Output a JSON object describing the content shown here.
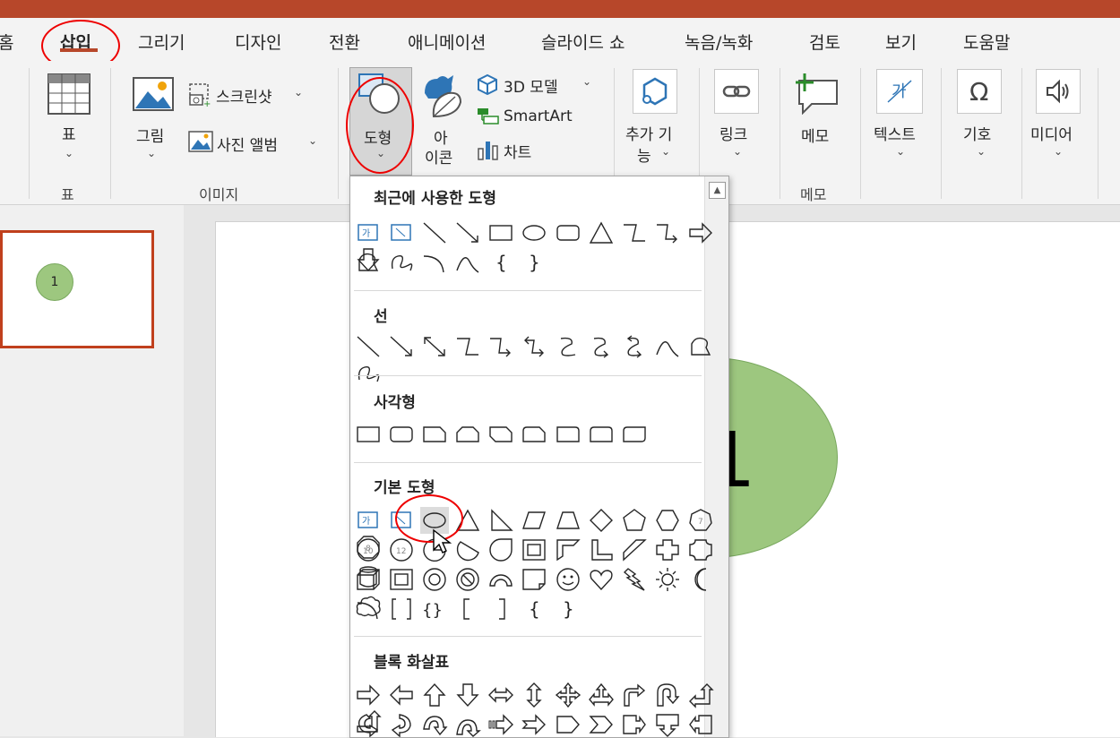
{
  "tabs": [
    {
      "label": "홈",
      "active": false
    },
    {
      "label": "삽입",
      "active": true
    },
    {
      "label": "그리기",
      "active": false
    },
    {
      "label": "디자인",
      "active": false
    },
    {
      "label": "전환",
      "active": false
    },
    {
      "label": "애니메이션",
      "active": false
    },
    {
      "label": "슬라이드 쇼",
      "active": false
    },
    {
      "label": "녹음/녹화",
      "active": false
    },
    {
      "label": "검토",
      "active": false
    },
    {
      "label": "보기",
      "active": false
    },
    {
      "label": "도움말",
      "active": false
    }
  ],
  "ribbon": {
    "table_label": "표",
    "table_group": "표",
    "picture_label": "그림",
    "screenshot_label": "스크린샷",
    "photo_album_label": "사진 앨범",
    "images_group": "이미지",
    "shapes_label": "도형",
    "icons_label_1": "아",
    "icons_label_2": "이콘",
    "model3d_label": "3D 모델",
    "smartart_label": "SmartArt",
    "chart_label": "차트",
    "addins_label_1": "추가 기",
    "addins_label_2": "능",
    "link_label": "링크",
    "comment_label": "메모",
    "comment_group": "메모",
    "text_label": "텍스트",
    "symbol_label": "기호",
    "media_label": "미디어"
  },
  "slide": {
    "thumb_number": "1",
    "circle_number": "1",
    "circle_color": "#9dc77f"
  },
  "shapes_menu": {
    "recent_title": "최근에 사용한 도형",
    "lines_title": "선",
    "rect_title": "사각형",
    "basic_title": "기본 도형",
    "block_arrows_title": "블록 화살표",
    "textbox_glyph": "가",
    "octagon_numbers": [
      "7",
      "8",
      "10",
      "12"
    ]
  },
  "colors": {
    "accent": "#b7472a",
    "annotation": "#e00000",
    "outline": "#262626"
  }
}
